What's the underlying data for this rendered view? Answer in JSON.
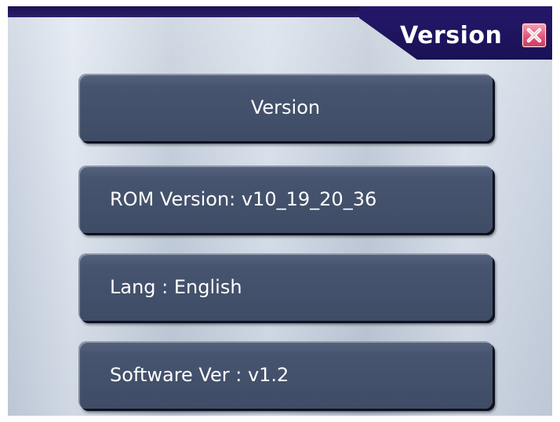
{
  "window": {
    "title": "Version"
  },
  "icons": {
    "close": "close-icon"
  },
  "colors": {
    "title_bar": "#1f1560",
    "panel": "#434f69",
    "panel_text": "#ffffff",
    "close_button": "#e0577a",
    "background": "#cfd7e3"
  },
  "panels": {
    "header_label": "Version",
    "rom": "ROM Version: v10_19_20_36",
    "lang": "Lang : English",
    "software": "Software Ver : v1.2"
  }
}
